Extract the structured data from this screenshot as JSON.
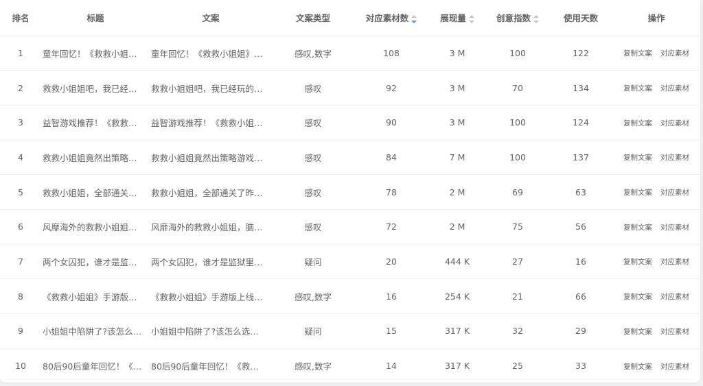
{
  "columns": {
    "rank": "排名",
    "title": "标题",
    "copy": "文案",
    "copy_type": "文案类型",
    "material_count": "对应素材数",
    "impressions": "展现量",
    "creative_index": "创意指数",
    "days_used": "使用天数",
    "actions": "操作"
  },
  "sort_state": {
    "material_count": "descending",
    "impressions": "none",
    "creative_index": "none"
  },
  "colors": {
    "sort_active": "#409eff",
    "sort_inactive": "#c0c4cc",
    "text": "#606266"
  },
  "actions": {
    "copy_label": "复制文案",
    "material_label": "对应素材"
  },
  "rows": [
    {
      "rank": "1",
      "title": "童年回忆！《救救小姐…",
      "copy": "童年回忆！《救救小姐姐》…",
      "copy_type": "感叹,数字",
      "material_count": "108",
      "impressions": "3 M",
      "creative_index": "100",
      "days_used": "122"
    },
    {
      "rank": "2",
      "title": "救救小姐姐吧，我已经…",
      "copy": "救救小姐姐吧，我已经玩的…",
      "copy_type": "感叹",
      "material_count": "92",
      "impressions": "3 M",
      "creative_index": "70",
      "days_used": "134"
    },
    {
      "rank": "3",
      "title": "益智游戏推荐！《救救…",
      "copy": "益智游戏推荐！《救救小姐…",
      "copy_type": "感叹",
      "material_count": "90",
      "impressions": "3 M",
      "creative_index": "100",
      "days_used": "124"
    },
    {
      "rank": "4",
      "title": "救救小姐姐竟然出策略…",
      "copy": "救救小姐姐竟然出策略游戏…",
      "copy_type": "感叹",
      "material_count": "84",
      "impressions": "7 M",
      "creative_index": "100",
      "days_used": "137"
    },
    {
      "rank": "5",
      "title": "救救小姐姐，全部通关…",
      "copy": "救救小姐姐，全部通关了昨…",
      "copy_type": "感叹",
      "material_count": "78",
      "impressions": "2 M",
      "creative_index": "69",
      "days_used": "63"
    },
    {
      "rank": "6",
      "title": "风靡海外的救救小姐姐…",
      "copy": "风靡海外的救救小姐姐，脑…",
      "copy_type": "感叹",
      "material_count": "72",
      "impressions": "2 M",
      "creative_index": "75",
      "days_used": "56"
    },
    {
      "rank": "7",
      "title": "两个女囚犯，谁才是监…",
      "copy": "两个女囚犯，谁才是监狱里…",
      "copy_type": "疑问",
      "material_count": "20",
      "impressions": "444 K",
      "creative_index": "27",
      "days_used": "16"
    },
    {
      "rank": "8",
      "title": "《救救小姐姐》手游版…",
      "copy": "《救救小姐姐》手游版上线…",
      "copy_type": "感叹,数字",
      "material_count": "16",
      "impressions": "254 K",
      "creative_index": "21",
      "days_used": "66"
    },
    {
      "rank": "9",
      "title": "小姐姐中陷阱了?该怎么…",
      "copy": "小姐姐中陷阱了?该怎么选…",
      "copy_type": "疑问",
      "material_count": "15",
      "impressions": "317 K",
      "creative_index": "32",
      "days_used": "29"
    },
    {
      "rank": "10",
      "title": "80后90后童年回忆！《…",
      "copy": "80后90后童年回忆！《救…",
      "copy_type": "感叹,数字",
      "material_count": "14",
      "impressions": "317 K",
      "creative_index": "25",
      "days_used": "33"
    }
  ]
}
